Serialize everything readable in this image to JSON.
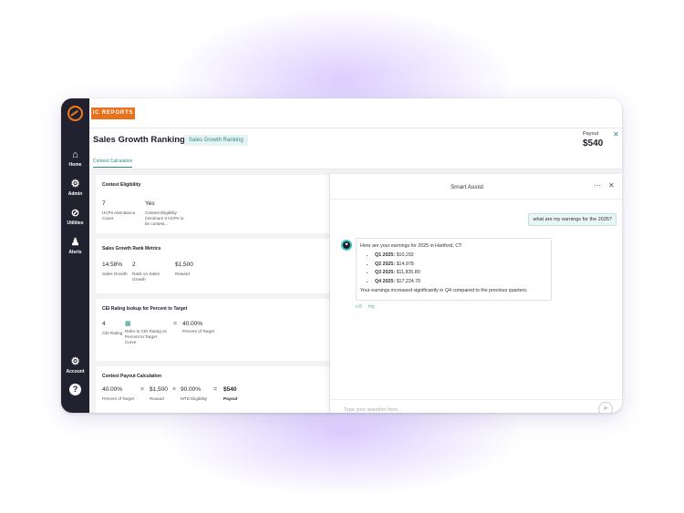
{
  "app": {
    "badge": "IC REPORTS"
  },
  "nav": [
    {
      "label": "Home",
      "icon": "home-icon"
    },
    {
      "label": "Admin",
      "icon": "gear-icon"
    },
    {
      "label": "Utilities",
      "icon": "utilities-icon"
    },
    {
      "label": "Alerts",
      "icon": "bell-icon"
    },
    {
      "label": "Account",
      "icon": "gear-icon"
    }
  ],
  "header": {
    "title": "Sales Growth Ranking",
    "chip": "Sales Growth Ranking",
    "payout_label": "Payout",
    "payout_value": "$540",
    "tab": "Contest Calculation"
  },
  "cards": {
    "eligibility": {
      "title": "Contest Eligibility",
      "c1_value": "7",
      "c1_label": "HCPs Attendance Count",
      "c2_value": "Yes",
      "c2_label": "Contest Eligibility (minimum 3 HCPs to be contest..."
    },
    "rank": {
      "title": "Sales Growth Rank Metrics",
      "c1_value": "14.58%",
      "c1_label": "Sales Growth",
      "c2_value": "2",
      "c2_label": "Rank on Sales Growth",
      "c3_value": "$1,500",
      "c3_label": "Reward"
    },
    "cei": {
      "title": "CEI Rating lookup for Percent to Target",
      "c1_value": "4",
      "c1_label": "CEI Rating",
      "c2_label": "Refer to CEI Rating vs Percent to Target Curve",
      "eq": "=",
      "c3_value": "40.00%",
      "c3_label": "Percent of Target"
    },
    "payout": {
      "title": "Contest Payout Calculation",
      "c1_value": "40.00%",
      "c1_label": "Percent of Target",
      "op1": "×",
      "c2_value": "$1,500",
      "c2_label": "Reward",
      "op2": "×",
      "c3_value": "90.00%",
      "c3_label": "MTD Eligibility",
      "eq": "=",
      "c4_value": "$540",
      "c4_label": "Payout"
    }
  },
  "assist": {
    "title": "Smart Assist",
    "user_message": "what are my earnings for the 2025?",
    "bot_intro": "Here are your earnings for 2025 in Hartford, CT:",
    "bot_items": [
      {
        "label": "Q1 2025:",
        "value": "$10,292"
      },
      {
        "label": "Q2 2025:",
        "value": "$14,978"
      },
      {
        "label": "Q3 2025:",
        "value": "$11,835.80"
      },
      {
        "label": "Q4 2025:",
        "value": "$17,224.70"
      }
    ],
    "bot_outro": "Your earnings increased significantly in Q4 compared to the previous quarters.",
    "composer_placeholder": "Type your question here..."
  },
  "colors": {
    "accent": "#2a8a8a",
    "brand_orange": "#e8721c",
    "rail": "#22212f"
  }
}
